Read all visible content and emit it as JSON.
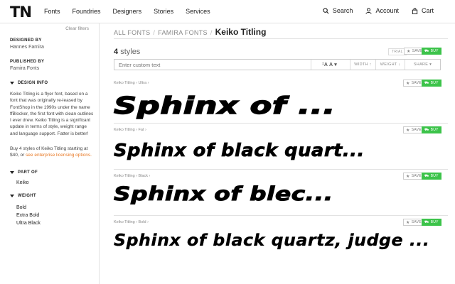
{
  "header": {
    "logo": "TN",
    "nav": [
      "Fonts",
      "Foundries",
      "Designers",
      "Stories",
      "Services"
    ],
    "search_label": "Search",
    "account_label": "Account",
    "cart_label": "Cart"
  },
  "sidebar": {
    "clear_filters": "Clear filters",
    "designed_by_label": "DESIGNED BY",
    "designed_by_value": "Hannes Famira",
    "published_by_label": "PUBLISHED BY",
    "published_by_value": "Famira Fonts",
    "design_info_label": "DESIGN INFO",
    "design_info_text": "Keiko Titling is a flyer font, based on a font that was originally re-leased by FontShop in the 1990s under the name ffBlocker, the first font with clean outlines I ever drew. Keiko Titling is a significant update in terms of style, weight range and language support. Fatter is better!",
    "buy_text": "Buy 4 styles of Keiko Titling starting at $40, or ",
    "buy_link": "see enterprise licensing options.",
    "part_of_label": "PART OF",
    "part_of_items": [
      "Keiko"
    ],
    "weight_label": "WEIGHT",
    "weight_items": [
      "Bold",
      "Extra Bold",
      "Ultra Black"
    ]
  },
  "main": {
    "breadcrumb": [
      "ALL FONTS",
      "FAMIRA FONTS"
    ],
    "breadcrumb_current": "Keiko Titling",
    "styles_count": "4",
    "styles_word": "styles",
    "trial_label": "TRIAL",
    "save_label": "SAVE",
    "buy_label": "BUY",
    "toolbar": {
      "placeholder": "Enter custom text",
      "stepper": "⇕",
      "size_label": "A A ▾",
      "width_label": "WIDTH ↑",
      "weight_label": "WEIGHT ↓",
      "share_label": "SHARE ▾"
    },
    "rows": [
      {
        "crumb": "Keiko Titling  ›  Ultra  ›",
        "specimen": "Sphinx of ..."
      },
      {
        "crumb": "Keiko Titling  ›  Fat  ›",
        "specimen": "Sphinx of black quart..."
      },
      {
        "crumb": "Keiko Titling  ›  Black  ›",
        "specimen": "Sphinx of blec..."
      },
      {
        "crumb": "Keiko Titling  ›  Bold  ›",
        "specimen": "Sphinx of black quartz, judge ..."
      }
    ]
  }
}
